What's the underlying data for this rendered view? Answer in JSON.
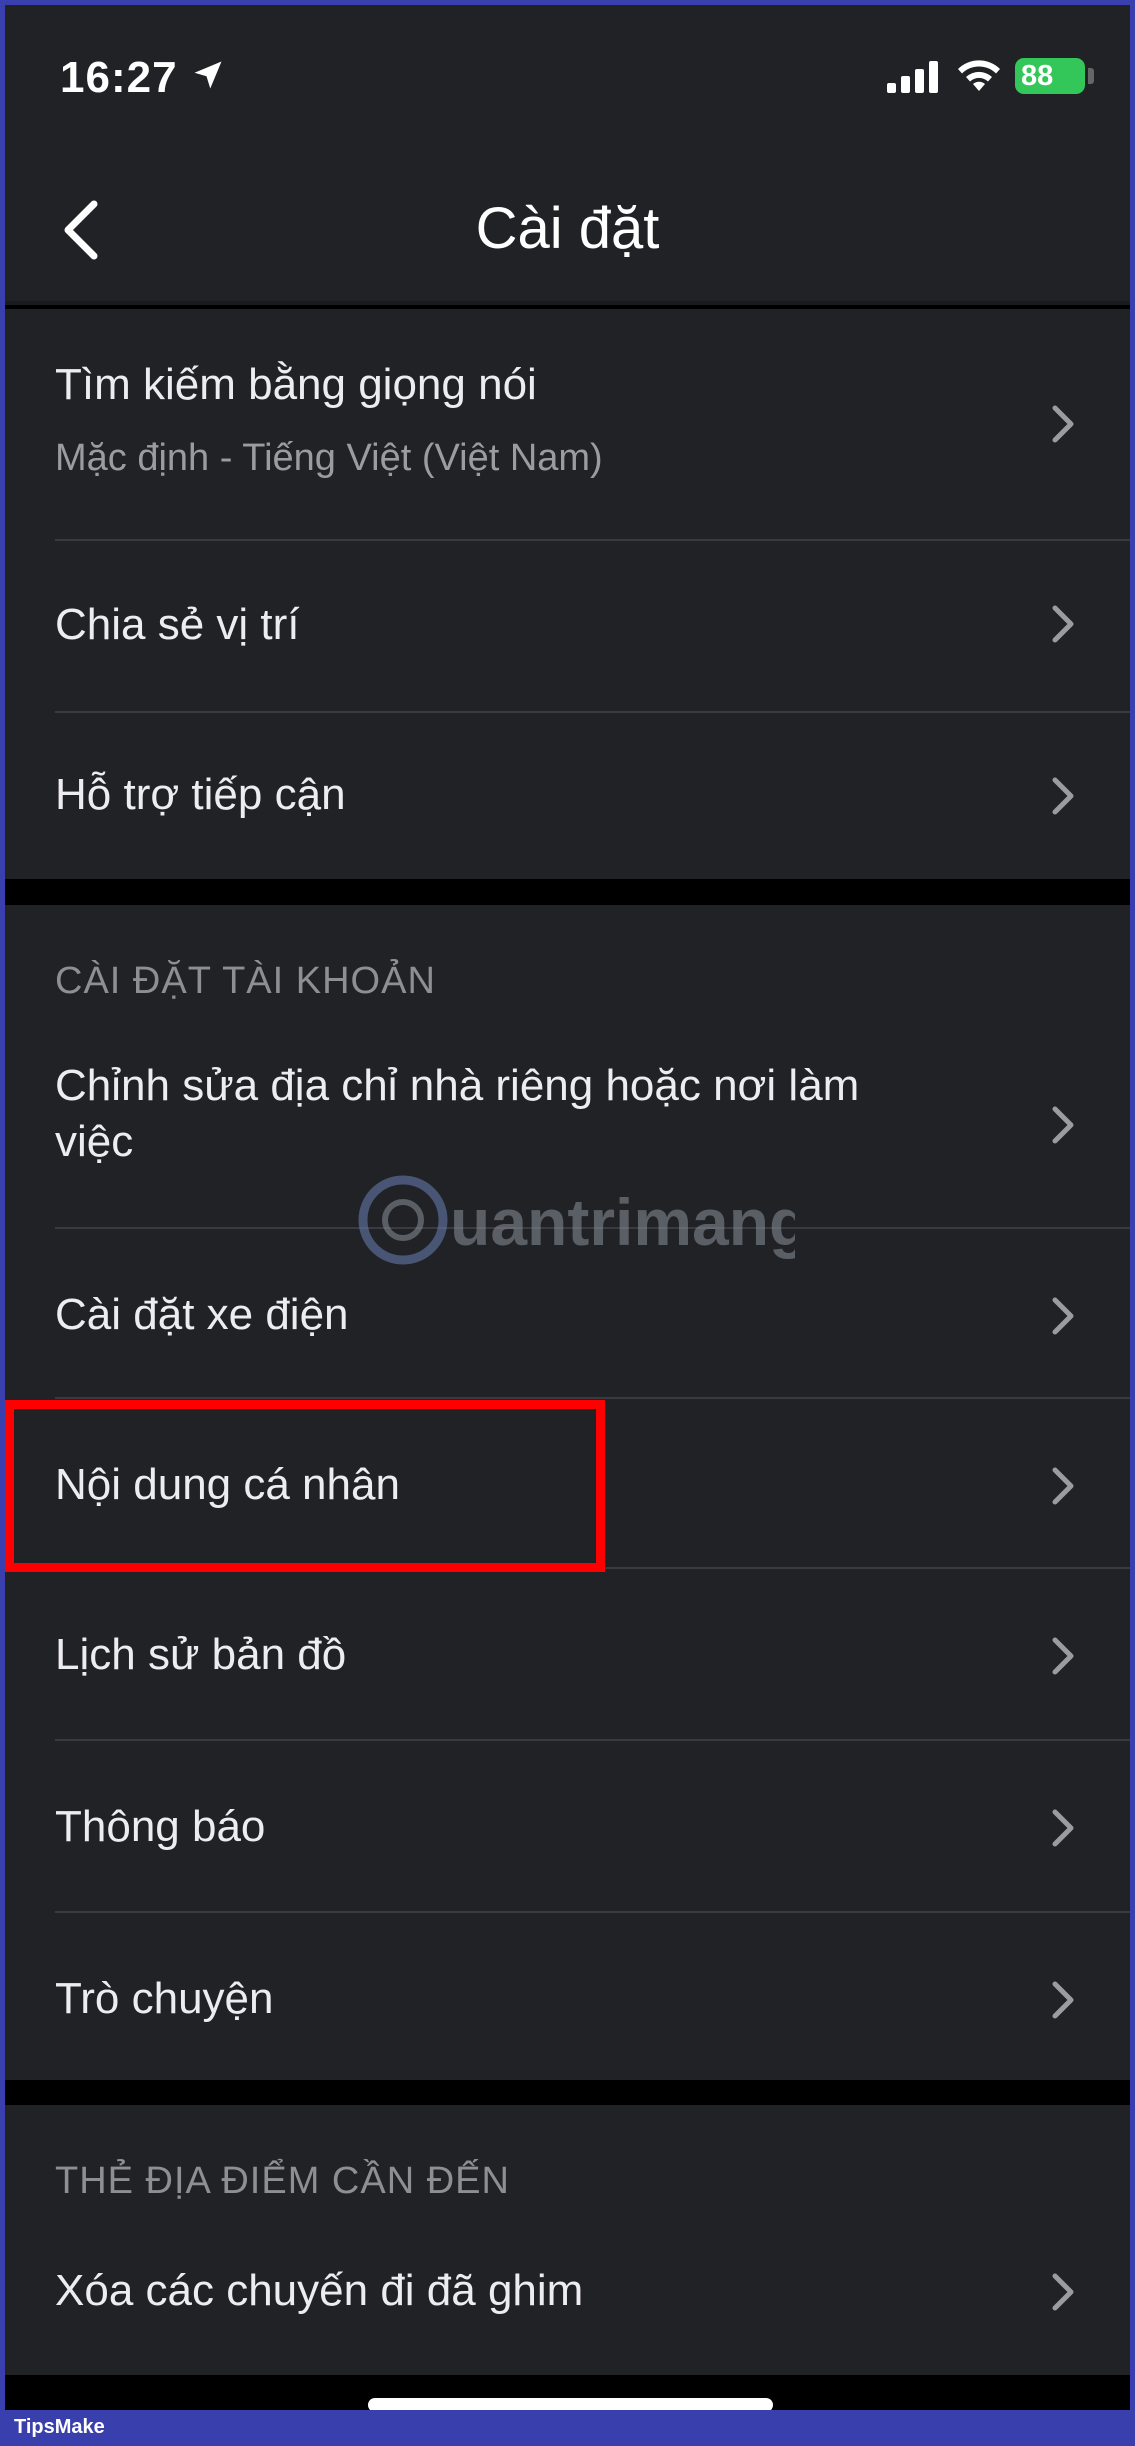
{
  "status_bar": {
    "time": "16:27",
    "battery": "88"
  },
  "nav": {
    "title": "Cài đặt"
  },
  "group1": {
    "voice_search": {
      "label": "Tìm kiếm bằng giọng nói",
      "sub": "Mặc định - Tiếng Việt (Việt Nam)"
    },
    "location_sharing": {
      "label": "Chia sẻ vị trí"
    },
    "accessibility": {
      "label": "Hỗ trợ tiếp cận"
    }
  },
  "account_section": {
    "header": "CÀI ĐẶT TÀI KHOẢN",
    "items": [
      {
        "label": "Chỉnh sửa địa chỉ nhà riêng hoặc nơi làm việc"
      },
      {
        "label": "Cài đặt xe điện"
      },
      {
        "label": "Nội dung cá nhân"
      },
      {
        "label": "Lịch sử bản đồ"
      },
      {
        "label": "Thông báo"
      },
      {
        "label": "Trò chuyện"
      }
    ]
  },
  "places_section": {
    "header": "THẺ ĐỊA ĐIỂM CẦN ĐẾN",
    "items": [
      {
        "label": "Xóa các chuyến đi đã ghim"
      }
    ]
  },
  "watermark": {
    "text": "Quantrimang"
  },
  "footer": {
    "brand": "TipsMake"
  }
}
